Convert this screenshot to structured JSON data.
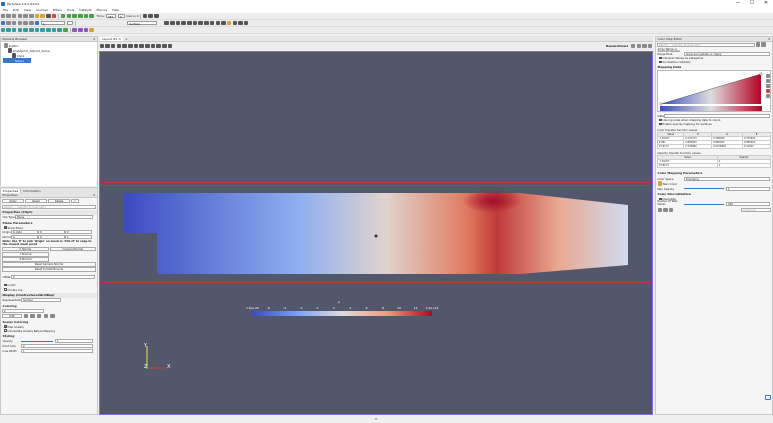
{
  "window": {
    "title": "ParaView 5.6.0 64-bit",
    "minimize": "—",
    "maximize": "☐",
    "close": "✕"
  },
  "menu": [
    "File",
    "Edit",
    "View",
    "Sources",
    "Filters",
    "Tools",
    "Catalyst",
    "Macros",
    "Help"
  ],
  "toolbar": {
    "time_label": "Time:",
    "time_value": "387",
    "time_step": "0",
    "max_is": "max is 0",
    "representation": "Surface",
    "color_var": "p"
  },
  "pipeline": {
    "title": "Pipeline Browser",
    "items": [
      "builtin:",
      "pmAdjoint_Adjoint_Solve",
      "Clip1",
      "Slice1"
    ]
  },
  "props": {
    "tabs": [
      "Properties",
      "Information"
    ],
    "title": "Properties",
    "buttons": {
      "apply": "Apply",
      "reset": "Reset",
      "delete": "Delete",
      "help": "?"
    },
    "search_placeholder": "Search ... (use Esc to clear text)",
    "section_clip": "Properties (Clip1)",
    "clip_type_label": "Clip Type",
    "clip_type": "Plane",
    "plane_params": "Plane Parameters",
    "show_plane": "Show Plane",
    "origin_label": "Origin",
    "origin": [
      "0.1441",
      "0",
      "0"
    ],
    "normal_label": "Normal",
    "normal": [
      "0",
      "0",
      "1"
    ],
    "note": "Note: Use 'P' to pick 'Origin' on mesh or 'Ctrl+P' to snap to the closest mesh point",
    "x_normal": "X Normal",
    "y_normal": "Y Normal",
    "z_normal": "Z Normal",
    "camera_normal": "Camera Normal",
    "reset_camera_normal": "Reset Camera Normal",
    "reset_bounds": "Reset to Data Bounds",
    "offset_label": "Offset",
    "offset": "0",
    "invert": "Invert",
    "crinkle": "Crinkle clip",
    "section_display": "Display (UnstructuredGridRepr",
    "repr_label": "Representation",
    "repr": "Surface",
    "coloring": "Coloring",
    "color_by": "p",
    "edit": "Edit",
    "scalar_coloring": "Scalar Coloring",
    "map_scalars": "Map Scalars",
    "interpolate": "Interpolate Scalars Before Mapping",
    "styling": "Styling",
    "opacity_label": "Opacity",
    "opacity": "1",
    "point_size_label": "Point Size",
    "point_size": "2",
    "line_width_label": "Line Width",
    "line_width": "1"
  },
  "view": {
    "tab": "Layout #1",
    "close": "✕",
    "plus": "+",
    "name": "RenderView1"
  },
  "colorbar": {
    "var": "p",
    "ticks": [
      "-7.8e+00",
      "-6",
      "-4",
      "-2",
      "0",
      "2",
      "4",
      "6",
      "8",
      "10",
      "12",
      "1.6e+01"
    ]
  },
  "axes": {
    "x": "X",
    "y": "Y",
    "z": "Z"
  },
  "cme": {
    "title": "Color Map Editor",
    "search_placeholder": "Search ... (use Esc to clear text)",
    "array_label": "Array Name: p",
    "auto_rescale_label": "Automatic Rescale Range Mode",
    "auto_rescale": "Grow and update on 'Apply'",
    "interpret": "Interpret Values As Categories",
    "annotate": "Annotations Visibility",
    "mapping": "Mapping Data",
    "data_label": "Data:",
    "log_scale": "Use log scale when mapping data to colors",
    "opacity_map": "Enable opacity mapping for surfaces",
    "transfer_title": "Color transfer function values",
    "transfer_headers": [
      "Value",
      "R",
      "G",
      "B"
    ],
    "transfer_rows": [
      [
        "-7.81707",
        "0.231373",
        "0.298039",
        "0.752941"
      ],
      [
        "3.991",
        "0.865003",
        "0.865003",
        "0.865003"
      ],
      [
        "15.8173",
        "0.705882",
        "0.0156863",
        "0.14902"
      ]
    ],
    "opacity_title": "Opacity transfer function values",
    "opacity_headers": [
      "Value",
      "Opacity"
    ],
    "opacity_rows": [
      [
        "-7.81707",
        "0"
      ],
      [
        "15.8173",
        "1"
      ]
    ],
    "params": "Color Mapping Parameters",
    "color_space_label": "Color Space",
    "color_space": "Diverging",
    "nan_color": "Nan Color",
    "nan_opacity_label": "Nan Opacity",
    "nan_opacity": "1",
    "disc": "Color Discretization",
    "discretize": "Discretize",
    "num_values_label": "Number Of Table Values",
    "num_values": "256",
    "advanced_placeholder": "Advanced"
  },
  "colors": {
    "accent": "#7d6ee6",
    "viewport_bg": "#52576b",
    "clip_line": "#c83232",
    "cool": "#3b4cc0",
    "neutral": "#dddddd",
    "warm": "#b40426"
  }
}
